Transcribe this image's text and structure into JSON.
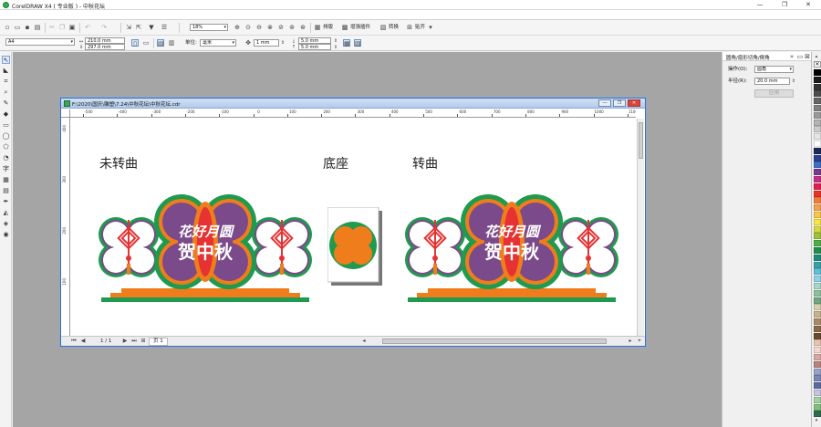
{
  "app": {
    "title": "CorelDRAW X4 ( 专业版 ) - 中秋花坛",
    "window_buttons": [
      "—",
      "❐",
      "✕"
    ]
  },
  "property_bar": {
    "paper_size": "A4",
    "width": "210.0 mm",
    "height": "297.0 mm",
    "units_label": "单位:",
    "units_value": "毫米",
    "nudge": "1 mm",
    "dup_x": "5.0 mm",
    "dup_y": "5.0 mm"
  },
  "standard_bar": {
    "zoom": "18%",
    "launch_labels": [
      "排版",
      "增强插件",
      "转换",
      "贴齐"
    ]
  },
  "document": {
    "title": "F:\\2020\\国庆\\雕塑\\7.24\\中秋花坛\\中秋花坛.cdr",
    "page_counter": "1 / 1",
    "page_tab": "页 1",
    "labels": {
      "uncurved": "未转曲",
      "base": "底座",
      "curved": "转曲"
    },
    "sign_text": {
      "line1": "花好月圆",
      "line2": "贺中秋"
    },
    "h_ruler": [
      "-500",
      "-400",
      "-300",
      "-200",
      "-100",
      "0",
      "100",
      "200",
      "300",
      "400",
      "500",
      "600",
      "700",
      "800",
      "900",
      "1000",
      "1100"
    ],
    "v_ruler": [
      "400",
      "300",
      "200",
      "100"
    ]
  },
  "docker": {
    "title": "圆角/扇形切角/倒角",
    "operation_label": "操作(O):",
    "operation_value": "圆角",
    "radius_label": "半径(R):",
    "radius_value": "20.0 mm",
    "apply_label": "应用"
  },
  "colors": {
    "green": "#1f9a4e",
    "purple": "#7b4a8a",
    "orange": "#ef7d1b",
    "red": "#e63232",
    "palette": [
      "#000000",
      "#1b1b1b",
      "#333333",
      "#4d4d4d",
      "#666666",
      "#808080",
      "#999999",
      "#b3b3b3",
      "#cccccc",
      "#e6e6e6",
      "#ffffff",
      "#1a2a5a",
      "#2d3f8f",
      "#3d6fc7",
      "#7a3b8c",
      "#c22f88",
      "#e61b4f",
      "#e8332a",
      "#f07d3a",
      "#f5a04a",
      "#f7c843",
      "#f6e63d",
      "#d7d83c",
      "#9ac43e",
      "#4fae47",
      "#1d8f4d",
      "#1e8a7a",
      "#3aa0a8",
      "#5cc0d8",
      "#8ed0e6",
      "#a9d4c8",
      "#8cbf9a",
      "#6fa77f",
      "#d4d0b0",
      "#c7b28d",
      "#a98a63",
      "#8a6848",
      "#6a4a2f",
      "#e8c4b0",
      "#f2d6cf",
      "#d9a7a2",
      "#b8837e",
      "#97a3c8",
      "#7a86b6",
      "#5c6aa0",
      "#c4c4e0",
      "#a0d0a0",
      "#7cc07c",
      "#2e6b4f"
    ]
  }
}
